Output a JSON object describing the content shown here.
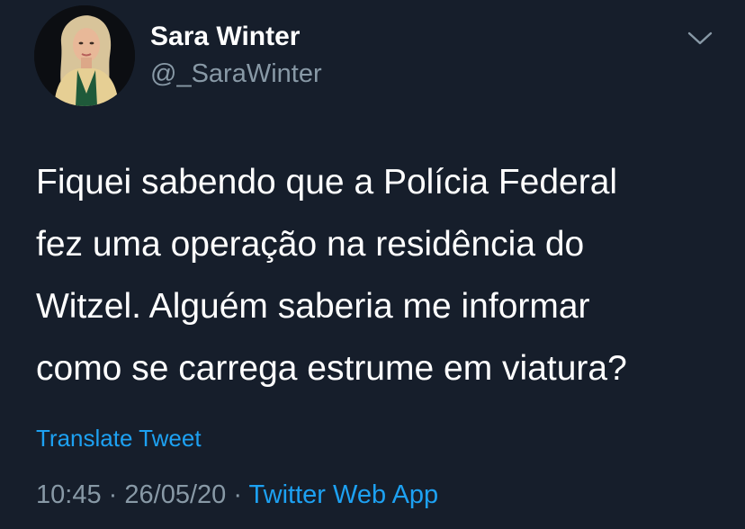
{
  "tweet": {
    "author_name": "Sara Winter",
    "author_handle": "@_SaraWinter",
    "text_lines": [
      "Fiquei sabendo que a Polícia Federal",
      "fez uma operação na residência do",
      "Witzel. Alguém saberia me informar",
      "como se carrega estrume em viatura?"
    ],
    "translate_label": "Translate Tweet",
    "time": "10:45",
    "separator": "·",
    "date": "26/05/20",
    "source": "Twitter Web App"
  },
  "icons": {
    "menu": "chevron-down-icon",
    "avatar": "profile-photo"
  },
  "colors": {
    "background": "#161e2b",
    "text_primary": "#ffffff",
    "text_secondary": "#8899a6",
    "accent": "#1da1f2"
  }
}
